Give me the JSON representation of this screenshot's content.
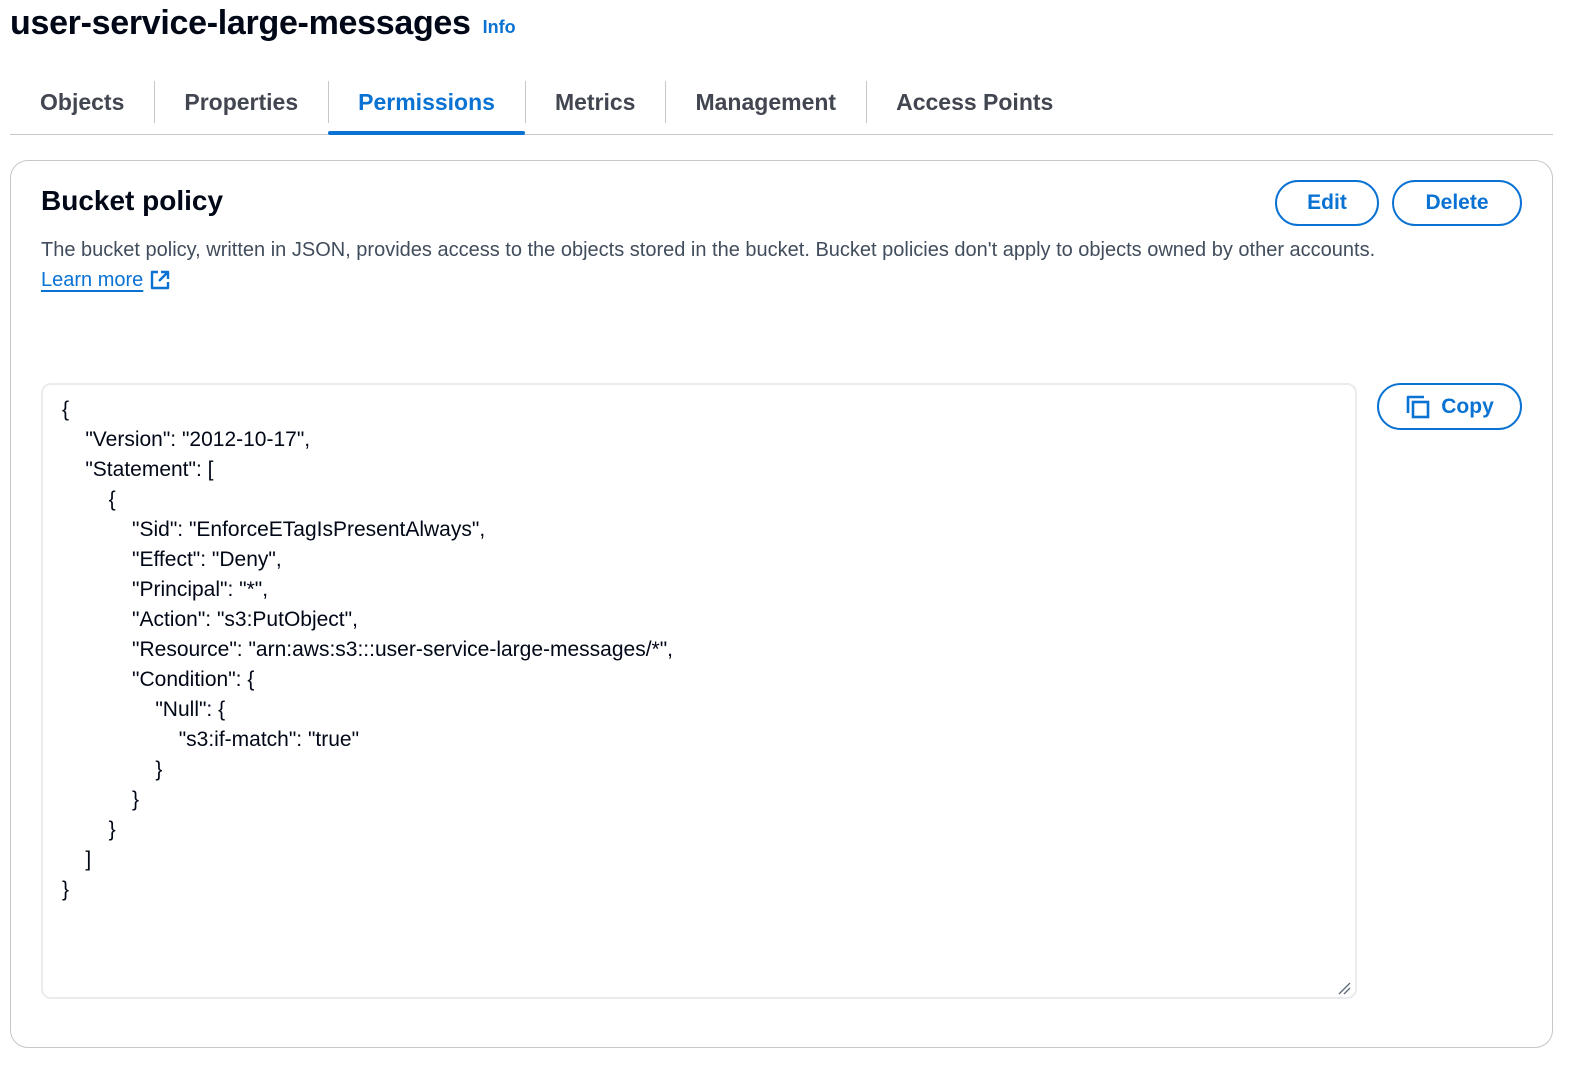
{
  "page": {
    "title": "user-service-large-messages",
    "info_label": "Info"
  },
  "tabs": [
    {
      "label": "Objects",
      "active": false
    },
    {
      "label": "Properties",
      "active": false
    },
    {
      "label": "Permissions",
      "active": true
    },
    {
      "label": "Metrics",
      "active": false
    },
    {
      "label": "Management",
      "active": false
    },
    {
      "label": "Access Points",
      "active": false
    }
  ],
  "bucket_policy": {
    "title": "Bucket policy",
    "description": "The bucket policy, written in JSON, provides access to the objects stored in the bucket. Bucket policies don't apply to objects owned by other accounts.",
    "learn_more_label": "Learn more",
    "edit_label": "Edit",
    "delete_label": "Delete",
    "copy_label": "Copy",
    "policy_json": "{\n    \"Version\": \"2012-10-17\",\n    \"Statement\": [\n        {\n            \"Sid\": \"EnforceETagIsPresentAlways\",\n            \"Effect\": \"Deny\",\n            \"Principal\": \"*\",\n            \"Action\": \"s3:PutObject\",\n            \"Resource\": \"arn:aws:s3:::user-service-large-messages/*\",\n            \"Condition\": {\n                \"Null\": {\n                    \"s3:if-match\": \"true\"\n                }\n            }\n        }\n    ]\n}"
  },
  "icons": {
    "external_link": "external-link-icon",
    "copy": "copy-icon",
    "resize": "resize-grip-icon"
  },
  "colors": {
    "accent": "#0972d3",
    "text": "#000716",
    "muted_text": "#414d5c",
    "border": "#c6c6cd"
  }
}
